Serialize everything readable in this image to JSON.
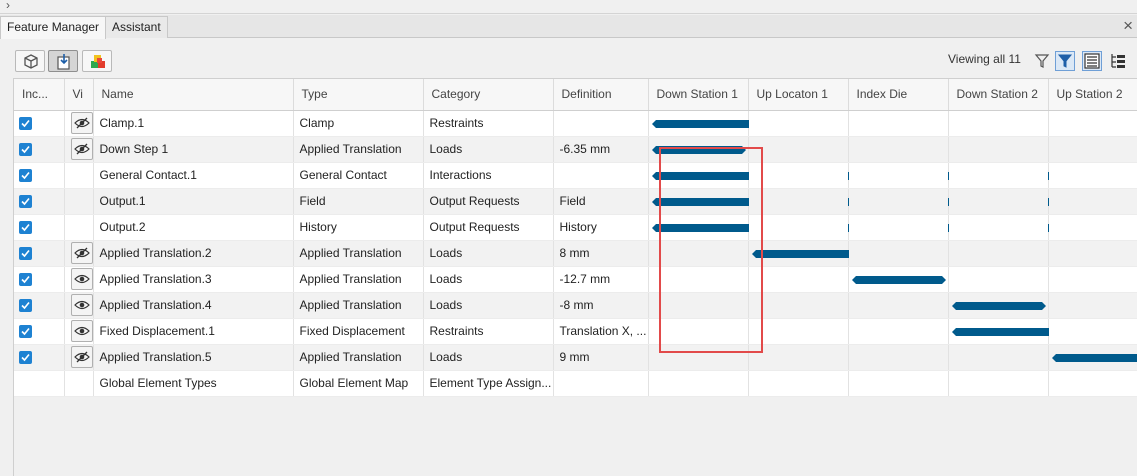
{
  "tabs": [
    {
      "label": "Feature Manager",
      "active": true
    },
    {
      "label": "Assistant",
      "active": false
    }
  ],
  "toolbar": {
    "viewing_label": "Viewing all 11"
  },
  "colors": {
    "bar": "#005a8c",
    "checkbox": "#1e82d2",
    "highlight": "#e24a4a"
  },
  "columns": [
    "Inc...",
    "Vi",
    "Name",
    "Type",
    "Category",
    "Definition",
    "Down Station 1",
    "Up Locaton 1",
    "Index Die",
    "Down Station 2",
    "Up Station 2"
  ],
  "rows": [
    {
      "included": true,
      "visibility": "hidden",
      "name": "Clamp.1",
      "type": "Clamp",
      "category": "Restraints",
      "definition": "",
      "bar_stations": [
        0,
        1
      ],
      "arrow_right_end": true
    },
    {
      "included": true,
      "visibility": "hidden",
      "name": "Down Step 1",
      "type": "Applied Translation",
      "category": "Loads",
      "definition": "-6.35 mm",
      "bar_stations": [
        0,
        0
      ],
      "arrow_right_end": true
    },
    {
      "included": true,
      "visibility": "none",
      "name": "General Contact.1",
      "type": "General Contact",
      "category": "Interactions",
      "definition": "",
      "bar_stations": [
        0,
        4
      ],
      "arrow_right_end": false
    },
    {
      "included": true,
      "visibility": "none",
      "name": "Output.1",
      "type": "Field",
      "category": "Output Requests",
      "definition": "Field",
      "bar_stations": [
        0,
        4
      ],
      "arrow_right_end": false
    },
    {
      "included": true,
      "visibility": "none",
      "name": "Output.2",
      "type": "History",
      "category": "Output Requests",
      "definition": "History",
      "bar_stations": [
        0,
        4
      ],
      "arrow_right_end": false
    },
    {
      "included": true,
      "visibility": "hidden",
      "name": "Applied Translation.2",
      "type": "Applied Translation",
      "category": "Loads",
      "definition": "8 mm",
      "bar_stations": [
        1,
        2
      ],
      "arrow_right_end": true
    },
    {
      "included": true,
      "visibility": "visible",
      "name": "Applied Translation.3",
      "type": "Applied Translation",
      "category": "Loads",
      "definition": "-12.7 mm",
      "bar_stations": [
        2,
        2
      ],
      "arrow_right_end": true
    },
    {
      "included": true,
      "visibility": "visible",
      "name": "Applied Translation.4",
      "type": "Applied Translation",
      "category": "Loads",
      "definition": "-8 mm",
      "bar_stations": [
        3,
        3
      ],
      "arrow_right_end": true
    },
    {
      "included": true,
      "visibility": "visible",
      "name": "Fixed Displacement.1",
      "type": "Fixed Displacement",
      "category": "Restraints",
      "definition": "Translation X, ...",
      "bar_stations": [
        3,
        4
      ],
      "arrow_right_end": false
    },
    {
      "included": true,
      "visibility": "hidden",
      "name": "Applied Translation.5",
      "type": "Applied Translation",
      "category": "Loads",
      "definition": "9 mm",
      "bar_stations": [
        4,
        4
      ],
      "arrow_right_end": false
    },
    {
      "included": false,
      "visibility": "none",
      "name": "Global Element Types",
      "type": "Global Element Map",
      "category": "Element Type Assign...",
      "definition": "",
      "bar_stations": null,
      "arrow_right_end": false
    }
  ]
}
